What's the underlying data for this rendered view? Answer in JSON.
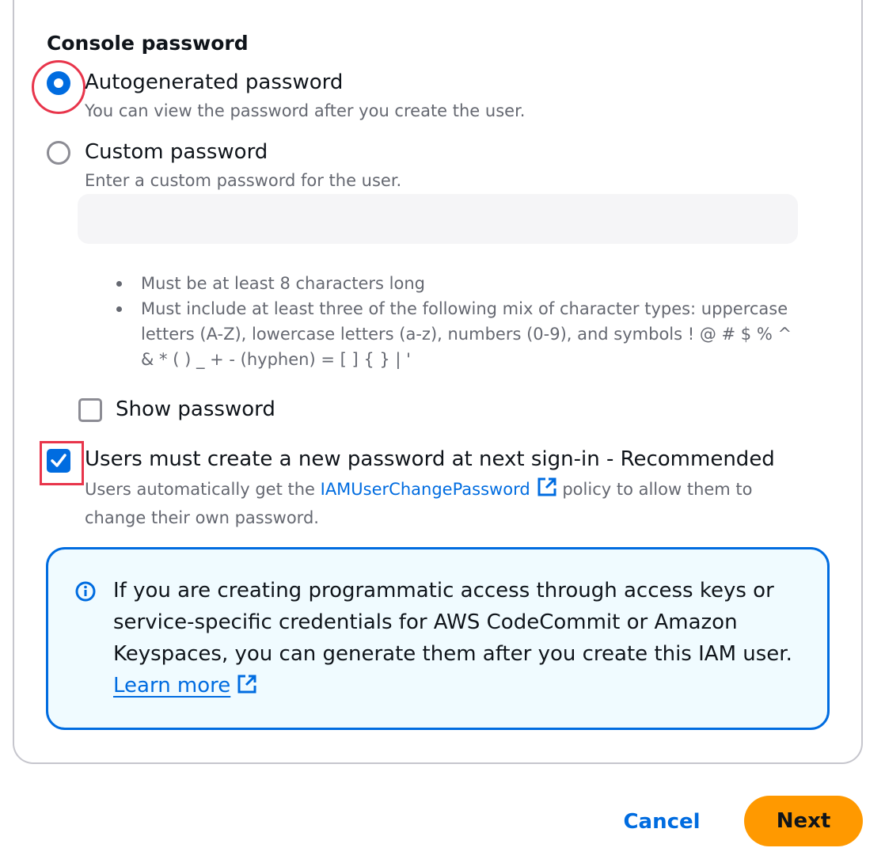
{
  "section": {
    "title": "Console password"
  },
  "options": {
    "autogenerated": {
      "label": "Autogenerated password",
      "description": "You can view the password after you create the user.",
      "selected": true
    },
    "custom": {
      "label": "Custom password",
      "description": "Enter a custom password for the user.",
      "selected": false,
      "input_value": "",
      "input_placeholder": ""
    }
  },
  "rules": [
    "Must be at least 8 characters long",
    "Must include at least three of the following mix of character types: uppercase letters (A-Z), lowercase letters (a-z), numbers (0-9), and symbols ! @ # $ % ^ & * ( ) _ + - (hyphen) = [ ] { } | '"
  ],
  "show_password": {
    "label": "Show password",
    "checked": false
  },
  "require_reset": {
    "label": "Users must create a new password at next sign-in - Recommended",
    "checked": true,
    "desc_prefix": "Users automatically get the ",
    "policy_link": "IAMUserChangePassword",
    "desc_suffix": " policy to allow them to change their own password."
  },
  "info": {
    "text": "If you are creating programmatic access through access keys or service-specific credentials for AWS CodeCommit or Amazon Keyspaces, you can generate them after you create this IAM user.",
    "link": "Learn more"
  },
  "footer": {
    "cancel_label": "Cancel",
    "next_label": "Next"
  },
  "colors": {
    "accent": "#006ce0",
    "primary_button": "#ff9900",
    "annotation": "#e8354b",
    "info_bg": "#f0fbff"
  },
  "icons": [
    "radio-selected",
    "radio-empty",
    "checkbox-empty",
    "checkbox-checked",
    "external-link-icon",
    "info-icon"
  ]
}
